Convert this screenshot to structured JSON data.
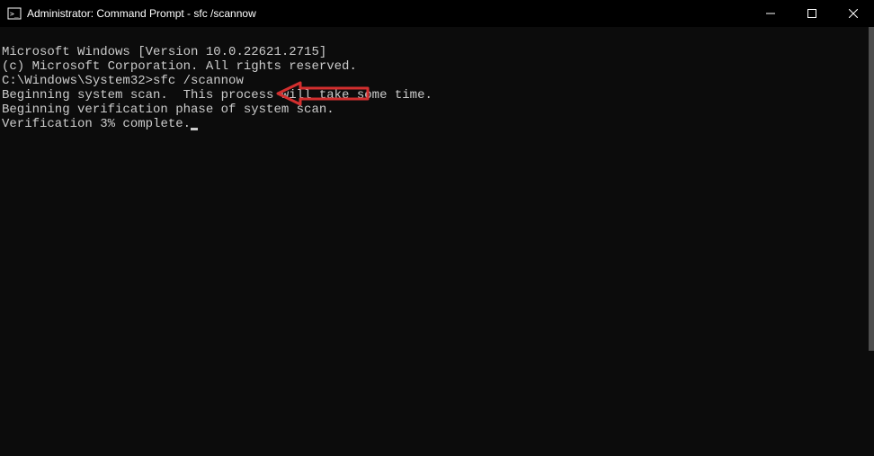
{
  "titlebar": {
    "title": "Administrator: Command Prompt - sfc  /scannow"
  },
  "terminal": {
    "line1": "Microsoft Windows [Version 10.0.22621.2715]",
    "line2": "(c) Microsoft Corporation. All rights reserved.",
    "blank1": "",
    "prompt": "C:\\Windows\\System32>",
    "command": "sfc /scannow",
    "blank2": "",
    "line3": "Beginning system scan.  This process will take some time.",
    "blank3": "",
    "line4": "Beginning verification phase of system scan.",
    "line5_prefix": "Verification ",
    "line5_percent": "3%",
    "line5_suffix": " complete."
  },
  "annotation": {
    "arrow_color": "#d32f2f"
  }
}
